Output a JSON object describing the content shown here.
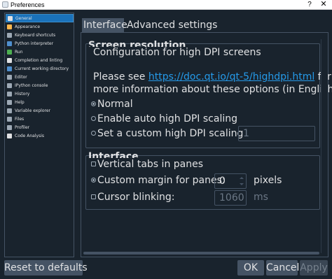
{
  "window": {
    "title": "Preferences",
    "help_label": "?",
    "close_label": "✕"
  },
  "sidebar": {
    "items": [
      {
        "label": "General",
        "icon": "gear-icon",
        "color": "#e0e1e3",
        "selected": true
      },
      {
        "label": "Appearance",
        "icon": "palette-icon",
        "color": "#ffb74d"
      },
      {
        "label": "Keyboard shortcuts",
        "icon": "keyboard-icon",
        "color": "#9da9b5"
      },
      {
        "label": "Python interpreter",
        "icon": "python-icon",
        "color": "#4f8fce"
      },
      {
        "label": "Run",
        "icon": "run-icon",
        "color": "#4caf50"
      },
      {
        "label": "Completion and linting",
        "icon": "completion-icon",
        "color": "#e0e1e3"
      },
      {
        "label": "Current working directory",
        "icon": "folder-icon",
        "color": "#4f8fce"
      },
      {
        "label": "Editor",
        "icon": "editor-icon",
        "color": "#9da9b5"
      },
      {
        "label": "IPython console",
        "icon": "console-icon",
        "color": "#9da9b5"
      },
      {
        "label": "History",
        "icon": "history-icon",
        "color": "#9da9b5"
      },
      {
        "label": "Help",
        "icon": "help-icon",
        "color": "#9da9b5"
      },
      {
        "label": "Variable explorer",
        "icon": "variable-explorer-icon",
        "color": "#9da9b5"
      },
      {
        "label": "Files",
        "icon": "files-icon",
        "color": "#9da9b5"
      },
      {
        "label": "Profiler",
        "icon": "profiler-icon",
        "color": "#9da9b5"
      },
      {
        "label": "Code Analysis",
        "icon": "code-analysis-icon",
        "color": "#e0e1e3"
      }
    ]
  },
  "tabs": [
    {
      "label": "Interface",
      "active": true
    },
    {
      "label": "Advanced settings",
      "active": false
    }
  ],
  "screen_resolution": {
    "title": "Screen resolution",
    "heading": "Configuration for high DPI screens",
    "see_prefix": "Please see ",
    "link": "https://doc.qt.io/qt-5/highdpi.html",
    "see_suffix": " for",
    "info_line2": "more information about these options (in English).",
    "options": [
      {
        "label": "Normal",
        "checked": true
      },
      {
        "label": "Enable auto high DPI scaling",
        "checked": false
      },
      {
        "label": "Set a custom high DPI scaling",
        "checked": false
      }
    ],
    "custom_scaling_value": "1"
  },
  "interface": {
    "title": "Interface",
    "vertical_tabs_label": "Vertical tabs in panes",
    "vertical_tabs_checked": false,
    "custom_margin_label": "Custom margin for panes:",
    "custom_margin_checked": true,
    "custom_margin_value": "0",
    "custom_margin_unit": "pixels",
    "cursor_blinking_label": "Cursor blinking:",
    "cursor_blinking_checked": false,
    "cursor_blinking_value": "1060",
    "cursor_blinking_unit": "ms"
  },
  "buttons": {
    "reset": "Reset to defaults",
    "ok": "OK",
    "cancel": "Cancel",
    "apply": "Apply"
  },
  "colors": {
    "background": "#19232d",
    "accent": "#1a72bb",
    "link": "#259ae9",
    "border": "#455364"
  }
}
